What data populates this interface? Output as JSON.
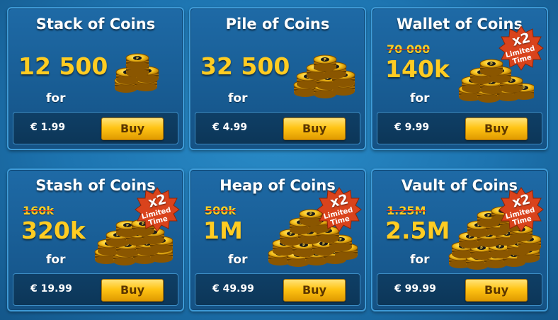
{
  "accent": {
    "gold": "#ffcc22",
    "badge": "#d9431c",
    "button": "#ffc414"
  },
  "buy_label": "Buy",
  "for_label": "for",
  "badge": {
    "multiplier": "x2",
    "line1": "Limited",
    "line2": "Time"
  },
  "coin_icon": "8-ball-coin-stack-icon",
  "offers": [
    {
      "title": "Stack of Coins",
      "old_amount": "",
      "amount": "12 500",
      "price": "€ 1.99",
      "limited": false
    },
    {
      "title": "Pile of Coins",
      "old_amount": "",
      "amount": "32 500",
      "price": "€ 4.99",
      "limited": false
    },
    {
      "title": "Wallet of Coins",
      "old_amount": "70 000",
      "amount": "140k",
      "price": "€ 9.99",
      "limited": true
    },
    {
      "title": "Stash of Coins",
      "old_amount": "160k",
      "amount": "320k",
      "price": "€ 19.99",
      "limited": true
    },
    {
      "title": "Heap of Coins",
      "old_amount": "500k",
      "amount": "1M",
      "price": "€ 49.99",
      "limited": true
    },
    {
      "title": "Vault of Coins",
      "old_amount": "1.25M",
      "amount": "2.5M",
      "price": "€ 99.99",
      "limited": true
    }
  ]
}
